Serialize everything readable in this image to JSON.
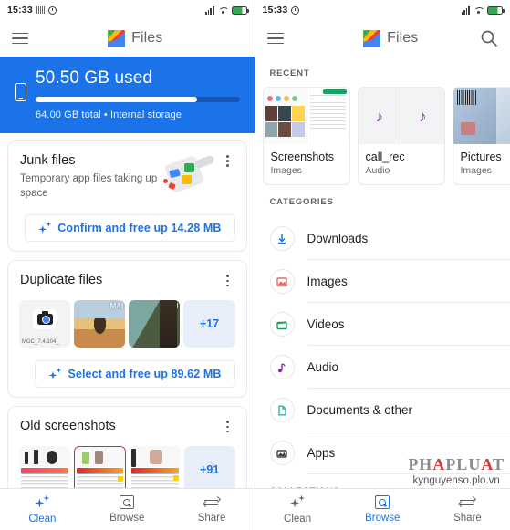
{
  "status_bar": {
    "time": "15:33",
    "icons": [
      "sim-card-icon",
      "alarm-icon",
      "signal-icon",
      "wifi-icon",
      "battery-icon"
    ]
  },
  "app": {
    "name": "Files",
    "logo_icon": "files-app-logo-icon",
    "menu_icon": "hamburger-menu-icon",
    "search_icon": "search-icon"
  },
  "left_panel": {
    "storage": {
      "used_label": "50.50 GB used",
      "total_label": "64.00 GB total • Internal storage",
      "used_percent": 79,
      "device_icon": "phone-icon",
      "bar_color": "#ffffff",
      "banner_color": "#1a73e8"
    },
    "cards": [
      {
        "title": "Junk files",
        "subtitle": "Temporary app files taking up space",
        "art_icon": "dustpan-junk-icon",
        "menu_icon": "kebab-menu-icon",
        "action": "Confirm and free up 14.28 MB",
        "action_icon": "sparkle-icon"
      },
      {
        "title": "Duplicate files",
        "menu_icon": "kebab-menu-icon",
        "thumbs": [
          {
            "type": "camera-file",
            "label": "MGC_7.4.104_"
          },
          {
            "type": "photo"
          },
          {
            "type": "photo"
          },
          {
            "type": "more",
            "label": "+17"
          }
        ],
        "action": "Select and free up 89.62 MB",
        "action_icon": "sparkle-icon"
      },
      {
        "title": "Old screenshots",
        "menu_icon": "kebab-menu-icon",
        "thumbs": [
          {
            "type": "screenshot"
          },
          {
            "type": "screenshot"
          },
          {
            "type": "screenshot"
          },
          {
            "type": "more",
            "label": "+91"
          }
        ]
      }
    ],
    "bottom_nav": {
      "active": "Clean",
      "items": [
        {
          "label": "Clean",
          "icon": "sparkle-icon"
        },
        {
          "label": "Browse",
          "icon": "browse-folder-search-icon"
        },
        {
          "label": "Share",
          "icon": "share-arrows-icon"
        }
      ]
    }
  },
  "right_panel": {
    "sections": {
      "recent": "RECENT",
      "categories": "CATEGORIES",
      "collections": "COLLECTIONS"
    },
    "recent_cards": [
      {
        "name": "Screenshots",
        "type": "Images",
        "art": "screenshots-preview"
      },
      {
        "name": "call_rec",
        "type": "Audio",
        "art": "audio-note-preview"
      },
      {
        "name": "Pictures",
        "type": "Images",
        "art": "pictures-preview"
      }
    ],
    "categories": [
      {
        "label": "Downloads",
        "icon": "download-icon",
        "color": "#1a73e8"
      },
      {
        "label": "Images",
        "icon": "image-icon",
        "color": "#e06c6c"
      },
      {
        "label": "Videos",
        "icon": "video-clapper-icon",
        "color": "#1e9e5a"
      },
      {
        "label": "Audio",
        "icon": "audio-note-icon",
        "color": "#8e24aa"
      },
      {
        "label": "Documents & other",
        "icon": "document-icon",
        "color": "#2bb3a3"
      },
      {
        "label": "Apps",
        "icon": "apps-icon",
        "color": "#3c4043"
      }
    ],
    "watermark": {
      "line1_a": "PH",
      "line1_b": "A",
      "line1_c": "PLU",
      "line1_d": "A",
      "line1_e": "T",
      "line1_full": "PHAPLUAT",
      "line2": "kynguyenso.plo.vn"
    },
    "bottom_nav": {
      "active": "Browse",
      "items": [
        {
          "label": "Clean",
          "icon": "sparkle-icon"
        },
        {
          "label": "Browse",
          "icon": "browse-folder-search-icon"
        },
        {
          "label": "Share",
          "icon": "share-arrows-icon"
        }
      ]
    }
  }
}
